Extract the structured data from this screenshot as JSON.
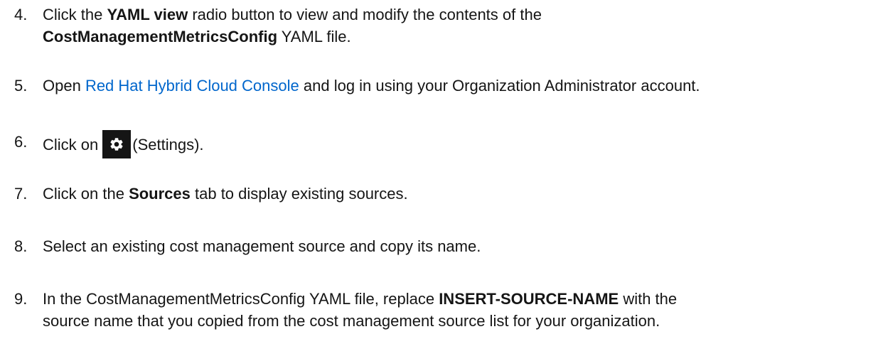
{
  "steps": [
    {
      "num": "4.",
      "pre": "Click the ",
      "bold": "YAML view",
      "post": " radio button to view and modify the contents of the",
      "line2_bold": "CostManagementMetricsConfig",
      "line2_post": " YAML file."
    },
    {
      "num": "5.",
      "pre": "Open ",
      "link": "Red Hat Hybrid Cloud Console",
      "post": "  and log in using your Organization Administrator account."
    },
    {
      "num": "6.",
      "pre": "Click on",
      "icon": "gear-icon",
      "post": "(Settings)."
    },
    {
      "num": "7.",
      "pre": "Click on the ",
      "bold": "Sources",
      "post": " tab to display existing sources."
    },
    {
      "num": "8.",
      "text": "Select an existing cost management source and copy its name."
    },
    {
      "num": "9.",
      "pre": "In the CostManagementMetricsConfig YAML file, replace ",
      "bold": "INSERT-SOURCE-NAME",
      "post": " with the",
      "line2": "source name that you copied from the cost management source list for your organization."
    }
  ],
  "colors": {
    "text": "#151515",
    "link": "#0066cc",
    "icon_bg": "#151515",
    "icon_fg": "#ffffff"
  }
}
